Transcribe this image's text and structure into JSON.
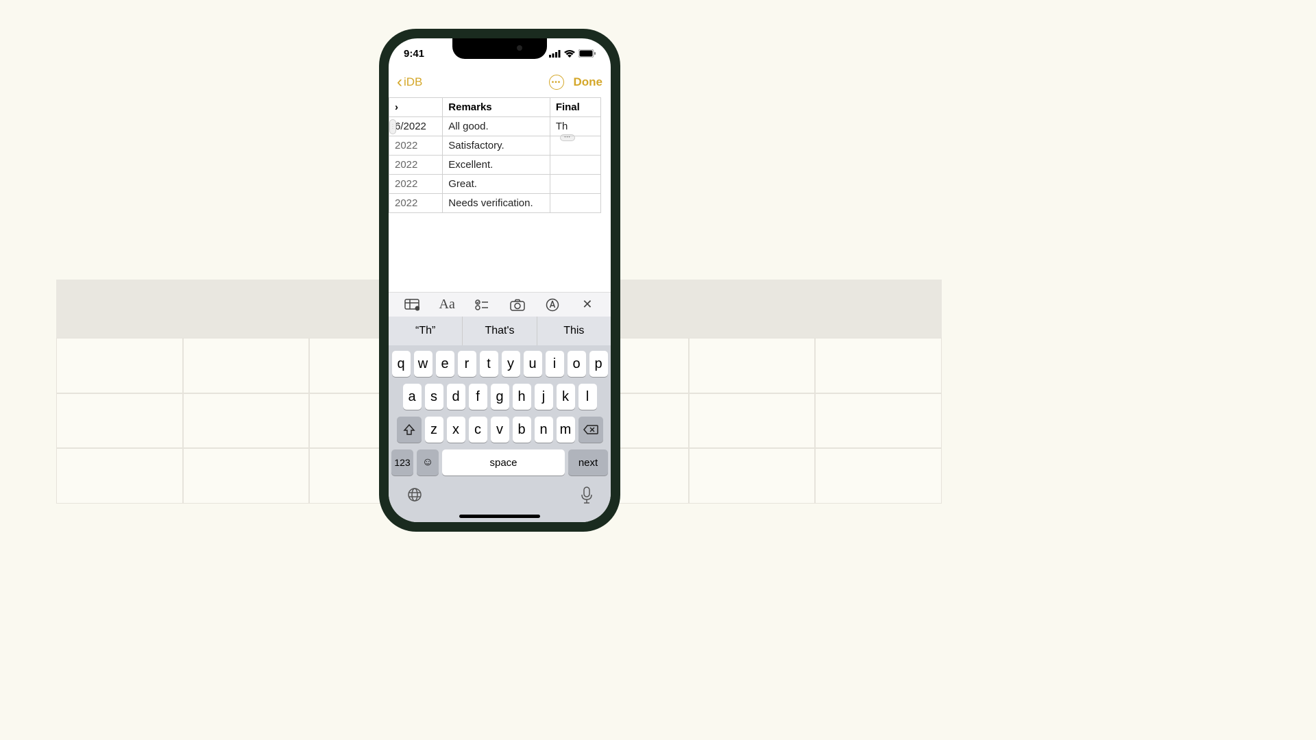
{
  "status": {
    "time": "9:41"
  },
  "nav": {
    "back_label": "iDB",
    "done_label": "Done"
  },
  "table": {
    "headers": {
      "date": "",
      "remarks": "Remarks",
      "final": "Final"
    },
    "rows": [
      {
        "date": "6/2022",
        "remarks": "All good.",
        "final": "Th"
      },
      {
        "date": "2022",
        "remarks": "Satisfactory.",
        "final": ""
      },
      {
        "date": "2022",
        "remarks": "Excellent.",
        "final": ""
      },
      {
        "date": "2022",
        "remarks": "Great.",
        "final": ""
      },
      {
        "date": "2022",
        "remarks": "Needs verification.",
        "final": ""
      }
    ]
  },
  "suggestions": {
    "s0": "“Th”",
    "s1": "That's",
    "s2": "This"
  },
  "keys": {
    "r1": {
      "k0": "q",
      "k1": "w",
      "k2": "e",
      "k3": "r",
      "k4": "t",
      "k5": "y",
      "k6": "u",
      "k7": "i",
      "k8": "o",
      "k9": "p"
    },
    "r2": {
      "k0": "a",
      "k1": "s",
      "k2": "d",
      "k3": "f",
      "k4": "g",
      "k5": "h",
      "k6": "j",
      "k7": "k",
      "k8": "l"
    },
    "r3": {
      "k0": "z",
      "k1": "x",
      "k2": "c",
      "k3": "v",
      "k4": "b",
      "k5": "n",
      "k6": "m"
    },
    "numbers": "123",
    "space": "space",
    "next": "next"
  }
}
